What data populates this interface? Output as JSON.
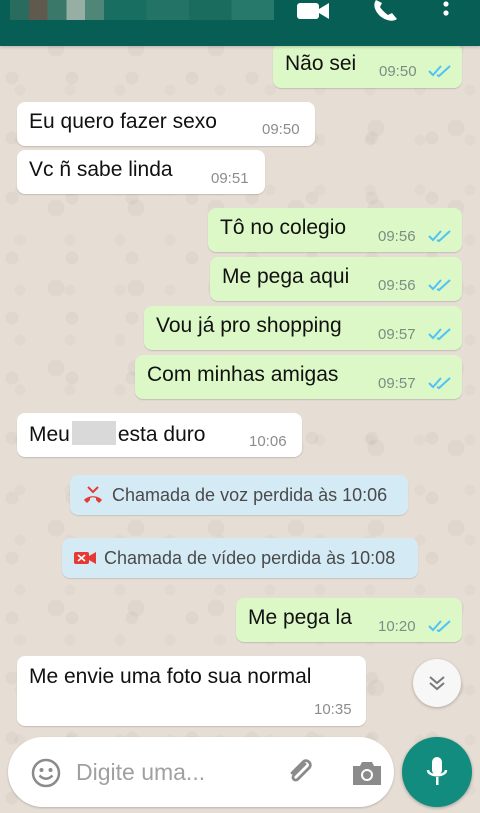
{
  "header": {
    "contact_name": "",
    "icons": [
      "video-call-icon",
      "voice-call-icon",
      "more-options-icon"
    ]
  },
  "messages": [
    {
      "dir": "out",
      "text": "Não sei",
      "time": "09:50",
      "status": "read"
    },
    {
      "dir": "in",
      "text": "Eu quero fazer sexo",
      "time": "09:50"
    },
    {
      "dir": "in",
      "text": "Vc ñ sabe linda",
      "time": "09:51"
    },
    {
      "dir": "out",
      "text": "Tô no colegio",
      "time": "09:56",
      "status": "read"
    },
    {
      "dir": "out",
      "text": "Me pega aqui",
      "time": "09:56",
      "status": "read"
    },
    {
      "dir": "out",
      "text": "Vou já pro shopping",
      "time": "09:57",
      "status": "read"
    },
    {
      "dir": "out",
      "text": "Com minhas amigas",
      "time": "09:57",
      "status": "read"
    },
    {
      "dir": "in",
      "text_before": "Meu",
      "text_after": "esta duro",
      "time": "10:06",
      "redacted": true
    },
    {
      "dir": "out",
      "text": "Me pega la",
      "time": "10:20",
      "status": "read"
    },
    {
      "dir": "in",
      "text": "Me envie uma foto sua normal",
      "time": "10:35"
    }
  ],
  "system_notices": [
    {
      "icon": "missed-voice-call-icon",
      "text": "Chamada de voz perdida às 10:06"
    },
    {
      "icon": "missed-video-call-icon",
      "text": "Chamada de vídeo perdida às 10:08"
    }
  ],
  "composer": {
    "placeholder": "Digite uma...",
    "value": ""
  },
  "colors": {
    "header": "#075e54",
    "outgoing_bubble": "#dcf8c6",
    "incoming_bubble": "#ffffff",
    "read_ticks": "#4fc3f7",
    "system_notice": "#d4eaf4",
    "mic_button": "#128c7e",
    "missed_call": "#e53935"
  }
}
